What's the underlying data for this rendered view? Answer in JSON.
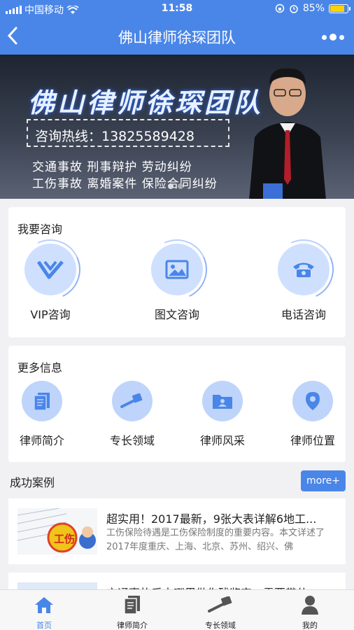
{
  "status_bar": {
    "carrier": "中国移动",
    "time": "11:58",
    "battery": "85%",
    "battery_level": 0.85
  },
  "nav": {
    "title": "佛山律师徐琛团队"
  },
  "banner": {
    "title": "佛山律师徐琛团队",
    "hotline": "咨询热线：13825589428",
    "line1": "交通事故  刑事辩护  劳动纠纷",
    "line2": "工伤事故  离婚案件  保险合同纠纷"
  },
  "consult": {
    "title": "我要咨询",
    "items": [
      {
        "label": "VIP咨询",
        "icon": "vip-icon"
      },
      {
        "label": "图文咨询",
        "icon": "image-icon"
      },
      {
        "label": "电话咨询",
        "icon": "phone-icon"
      }
    ]
  },
  "info": {
    "title": "更多信息",
    "items": [
      {
        "label": "律师简介",
        "icon": "document-icon"
      },
      {
        "label": "专长领域",
        "icon": "gavel-icon"
      },
      {
        "label": "律师风采",
        "icon": "folder-icon"
      },
      {
        "label": "律师位置",
        "icon": "location-icon"
      }
    ]
  },
  "cases": {
    "title": "成功案例",
    "more": "more+",
    "items": [
      {
        "title": "超实用！2017最新，9张大表详解6地工...",
        "desc": "工伤保险待遇是工伤保险制度的重要内容。本文详述了2017年度重庆、上海、北京、苏州、绍兴、佛",
        "thumb_text": "工伤"
      },
      {
        "title": "交通事故后去哪里做伤残鉴定，需要带什",
        "desc": ""
      }
    ]
  },
  "tabs": [
    {
      "label": "首页",
      "icon": "home-icon",
      "active": true
    },
    {
      "label": "律师简介",
      "icon": "document-icon",
      "active": false
    },
    {
      "label": "专长领域",
      "icon": "gavel-icon",
      "active": false
    },
    {
      "label": "我的",
      "icon": "user-icon",
      "active": false
    }
  ],
  "colors": {
    "primary": "#4a86e8",
    "icon_bg": "#cfe0ff"
  }
}
